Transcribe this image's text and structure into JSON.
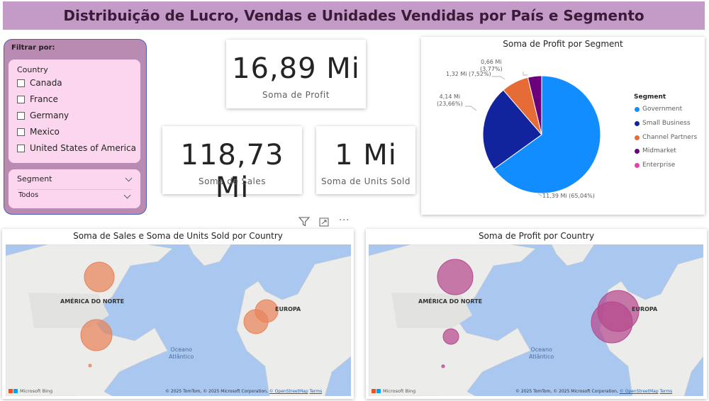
{
  "page": {
    "title": "Distribuição de Lucro, Vendas e Unidades Vendidas por País e Segmento"
  },
  "filters": {
    "panel_title": "Filtrar por:",
    "country": {
      "header": "Country",
      "options": [
        "Canada",
        "France",
        "Germany",
        "Mexico",
        "United States of America"
      ]
    },
    "segment": {
      "header": "Segment",
      "selected": "Todos"
    }
  },
  "kpis": {
    "profit": {
      "value": "16,89 Mi",
      "label": "Soma de Profit"
    },
    "sales": {
      "value": "118,73 Mi",
      "label": "Soma de Sales"
    },
    "units": {
      "value": "1 Mi",
      "label": "Soma de Units Sold"
    }
  },
  "pie": {
    "title": "Soma de Profit por Segment",
    "legend_title": "Segment",
    "labels": {
      "government": "11,39 Mi (65,04%)",
      "small_business_1": "4,14 Mi",
      "small_business_2": "(23,66%)",
      "channel_partners": "1,32 Mi (7,52%)",
      "midmarket_1": "0,66 Mi",
      "midmarket_2": "(3,77%)"
    }
  },
  "chart_data": {
    "type": "pie",
    "title": "Soma de Profit por Segment",
    "legend_title": "Segment",
    "categories": [
      "Government",
      "Small Business",
      "Channel Partners",
      "Midmarket",
      "Enterprise"
    ],
    "values": [
      11.39,
      4.14,
      1.32,
      0.66,
      0.0
    ],
    "percents": [
      65.04,
      23.66,
      7.52,
      3.77,
      0.0
    ],
    "colors": [
      "#118dff",
      "#12239e",
      "#e66c37",
      "#6b007b",
      "#e044a7"
    ],
    "legend_position": "right"
  },
  "toolbar": {
    "filter_icon": "filter-icon",
    "focus_icon": "focus-mode-icon",
    "more_icon": "more-options-icon",
    "more_label": "···"
  },
  "map_sales": {
    "title": "Soma de Sales e Soma de Units Sold por Country",
    "label_na": "AMÉRICA DO NORTE",
    "label_eu": "EUROPA",
    "ocean_1": "Oceano",
    "ocean_2": "Atlântico",
    "bubble_color": "#e8845a",
    "bing": "Microsoft Bing",
    "copyright": "© 2025 TomTom, © 2025 Microsoft Corporation,",
    "osm": "© OpenStreetMap",
    "terms": "Terms"
  },
  "map_profit": {
    "title": "Soma de Profit por Country",
    "label_na": "AMÉRICA DO NORTE",
    "label_eu": "EUROPA",
    "ocean_1": "Oceano",
    "ocean_2": "Atlântico",
    "bubble_color": "#b64a8e",
    "bing": "Microsoft Bing",
    "copyright": "© 2025 TomTom, © 2025 Microsoft Corporation,",
    "osm": "© OpenStreetMap",
    "terms": "Terms"
  }
}
